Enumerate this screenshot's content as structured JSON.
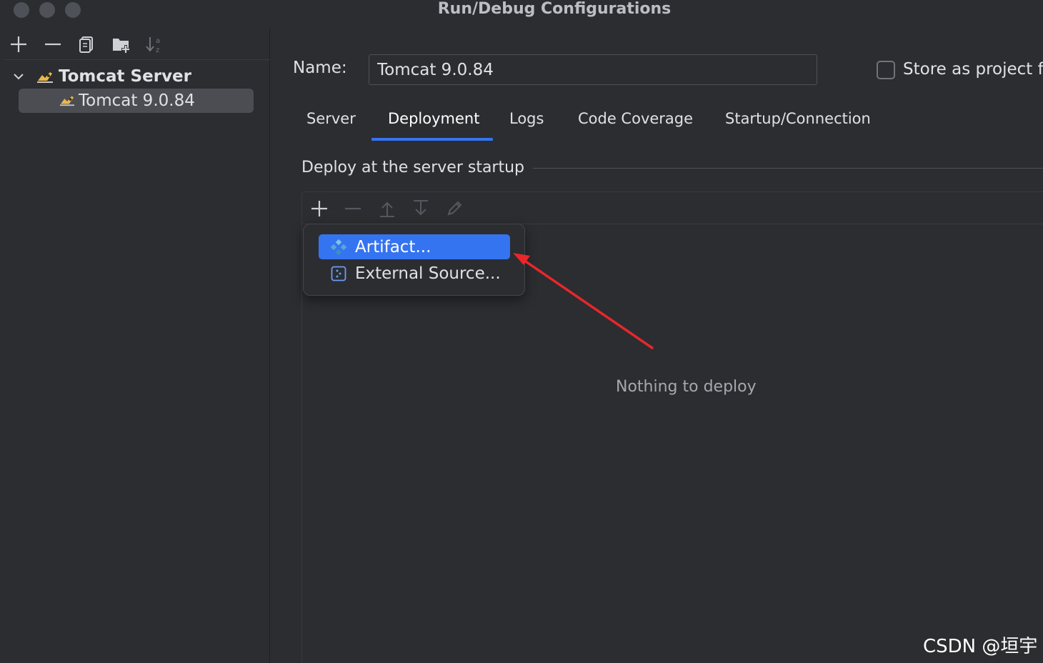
{
  "window": {
    "title": "Run/Debug Configurations"
  },
  "left_toolbar": {
    "icons": [
      "add-icon",
      "remove-icon",
      "copy-icon",
      "new-folder-icon",
      "sort-icon"
    ]
  },
  "tree": {
    "group_label": "Tomcat Server",
    "selected_item": "Tomcat 9.0.84"
  },
  "form": {
    "name_label": "Name:",
    "name_value": "Tomcat 9.0.84",
    "store_label": "Store as project fi",
    "store_checked": false
  },
  "tabs": [
    {
      "label": "Server"
    },
    {
      "label": "Deployment"
    },
    {
      "label": "Logs"
    },
    {
      "label": "Code Coverage"
    },
    {
      "label": "Startup/Connection"
    }
  ],
  "active_tab": "Deployment",
  "deploy": {
    "section_label": "Deploy at the server startup",
    "empty_text": "Nothing to deploy",
    "toolbar_icons": [
      "add-icon",
      "remove-icon",
      "move-up-icon",
      "move-down-icon",
      "edit-icon"
    ]
  },
  "popup_menu": {
    "items": [
      {
        "label": "Artifact...",
        "icon": "artifact-icon",
        "selected": true
      },
      {
        "label": "External Source...",
        "icon": "external-source-icon",
        "selected": false
      }
    ]
  },
  "colors": {
    "accent": "#3574f0",
    "annotation_arrow": "#e8262b",
    "background": "#2b2d30"
  },
  "watermark": "CSDN @垣宇"
}
